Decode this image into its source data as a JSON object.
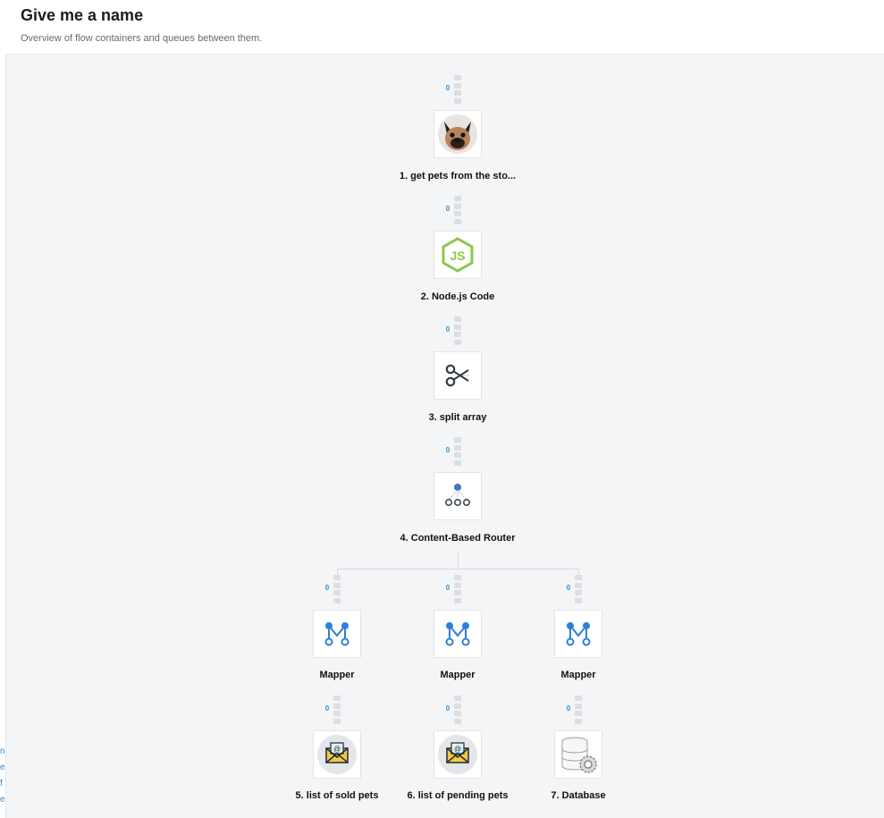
{
  "header": {
    "title": "Give me a name",
    "subtitle": "Overview of flow containers and queues between them."
  },
  "left_fragments": [
    "n",
    "e",
    "f",
    "e"
  ],
  "queues": {
    "q1": "0",
    "q2": "0",
    "q3": "0",
    "q4": "0",
    "q5a": "0",
    "q5b": "0",
    "q5c": "0",
    "q6a": "0",
    "q6b": "0",
    "q6c": "0"
  },
  "nodes": {
    "n1": {
      "label": "1. get pets from the sto...",
      "icon": "dog-photo-icon"
    },
    "n2": {
      "label": "2. Node.js Code",
      "icon": "nodejs-icon"
    },
    "n3": {
      "label": "3. split array",
      "icon": "scissors-icon"
    },
    "n4": {
      "label": "4. Content-Based Router",
      "icon": "router-icon"
    },
    "m1": {
      "label": "Mapper",
      "icon": "mapper-icon"
    },
    "m2": {
      "label": "Mapper",
      "icon": "mapper-icon"
    },
    "m3": {
      "label": "Mapper",
      "icon": "mapper-icon"
    },
    "n5": {
      "label": "5. list of sold pets",
      "icon": "email-icon"
    },
    "n6": {
      "label": "6. list of pending pets",
      "icon": "email-icon"
    },
    "n7": {
      "label": "7. Database",
      "icon": "database-icon"
    }
  },
  "colors": {
    "accent": "#2d8fd5",
    "nodejs_green": "#8cc84b",
    "mapper_blue": "#2f7fd8",
    "canvas": "#f4f5f7"
  }
}
